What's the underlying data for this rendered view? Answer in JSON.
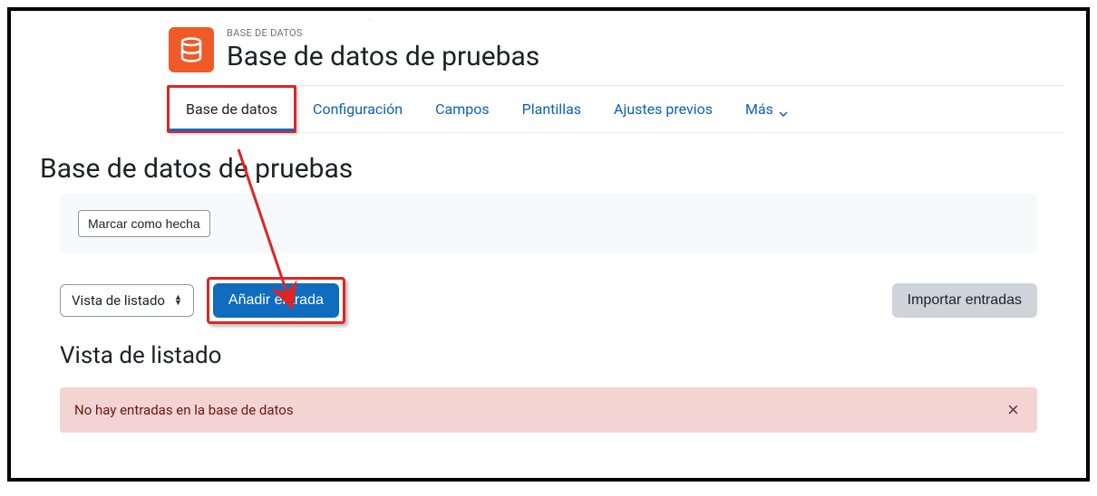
{
  "header": {
    "eyebrow": "BASE DE DATOS",
    "title": "Base de datos de pruebas"
  },
  "tabs": {
    "active": "Base de datos",
    "config": "Configuración",
    "fields": "Campos",
    "templates": "Plantillas",
    "presets": "Ajustes previos",
    "more": "Más"
  },
  "section": {
    "title": "Base de datos de pruebas",
    "markDone": "Marcar como hecha"
  },
  "controls": {
    "viewSelectLabel": "Vista de listado",
    "addEntry": "Añadir entrada",
    "importEntries": "Importar entradas"
  },
  "list": {
    "heading": "Vista de listado",
    "emptyAlert": "No hay entradas en la base de datos"
  },
  "colors": {
    "accent": "#0f6cbf",
    "headerIcon": "#f05a28",
    "annotation": "#e02424",
    "alertBg": "#f4d3d3",
    "alertText": "#691911"
  }
}
